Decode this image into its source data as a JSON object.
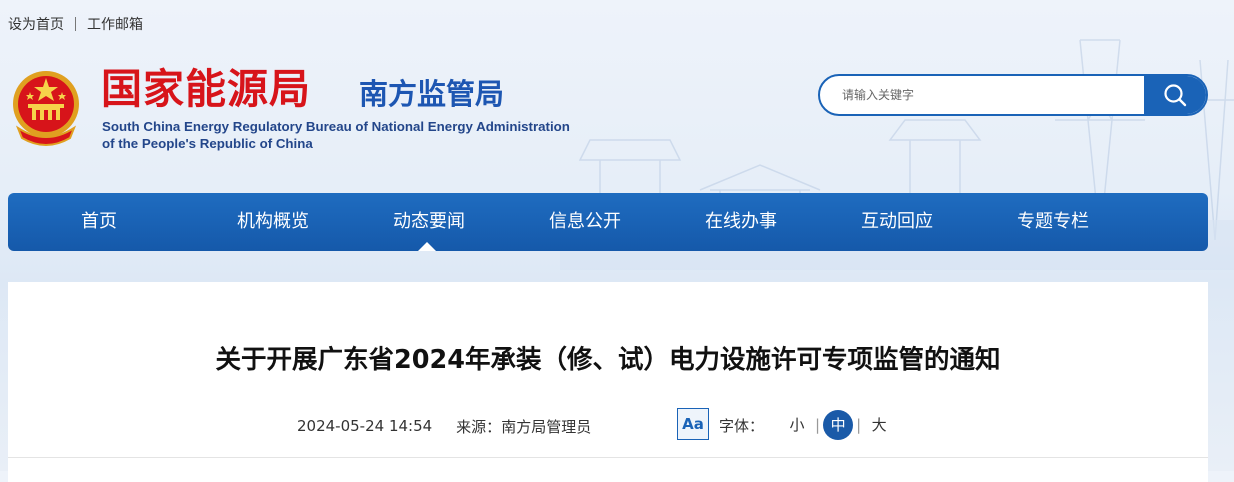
{
  "topbar": {
    "set_home": "设为首页",
    "work_mail": "工作邮箱"
  },
  "logo": {
    "title_cn": "国家能源局",
    "subtitle_cn": "南方监管局",
    "english_line1": "South China Energy Regulatory Bureau of National Energy Administration",
    "english_line2": "of the People's Republic of China"
  },
  "search": {
    "placeholder": "请输入关键字",
    "icon": "search-icon"
  },
  "nav": {
    "items": [
      {
        "label": "首页"
      },
      {
        "label": "机构概览"
      },
      {
        "label": "动态要闻",
        "active": true
      },
      {
        "label": "信息公开"
      },
      {
        "label": "在线办事"
      },
      {
        "label": "互动回应"
      },
      {
        "label": "专题专栏"
      }
    ]
  },
  "article": {
    "title": "关于开展广东省2024年承装（修、试）电力设施许可专项监管的通知",
    "date": "2024-05-24 14:54",
    "source_label": "来源：",
    "source_value": "南方局管理员"
  },
  "font_size": {
    "aa_icon": "Aa",
    "label": "字体：",
    "small": "小",
    "medium": "中",
    "large": "大",
    "selected": "中",
    "separator": "|"
  },
  "colors": {
    "brand_red": "#d7141a",
    "brand_blue": "#1a63b7",
    "nav_bg": "#1f6cc0"
  }
}
